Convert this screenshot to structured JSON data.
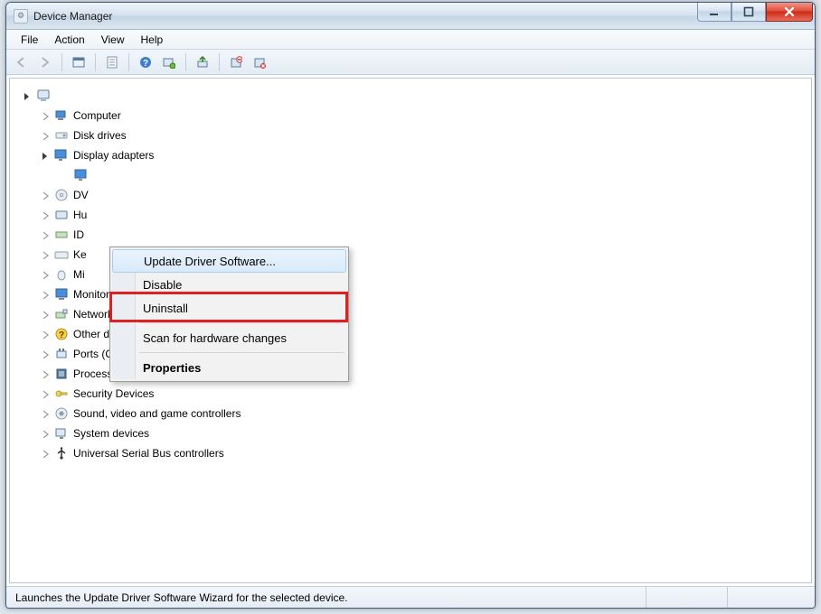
{
  "window": {
    "title": "Device Manager"
  },
  "menu": {
    "file": "File",
    "action": "Action",
    "view": "View",
    "help": "Help"
  },
  "tree": {
    "root": "",
    "items": [
      "Computer",
      "Disk drives",
      "Display adapters",
      "DVD/CD-ROM drives",
      "Human Interface Devices",
      "IDE ATA/ATAPI controllers",
      "Keyboards",
      "Mice and other pointing devices",
      "Monitors",
      "Network adapters",
      "Other devices",
      "Ports (COM & LPT)",
      "Processors",
      "Security Devices",
      "Sound, video and game controllers",
      "System devices",
      "Universal Serial Bus controllers"
    ],
    "visible_partial": [
      "DV",
      "Hu",
      "ID",
      "Ke",
      "Mi"
    ]
  },
  "contextmenu": {
    "update": "Update Driver Software...",
    "disable": "Disable",
    "uninstall": "Uninstall",
    "scan": "Scan for hardware changes",
    "properties": "Properties"
  },
  "status": {
    "text": "Launches the Update Driver Software Wizard for the selected device."
  }
}
